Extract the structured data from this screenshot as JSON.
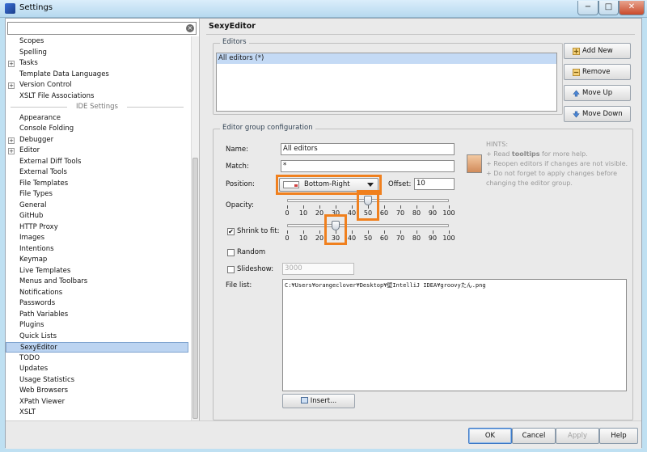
{
  "window": {
    "title": "Settings",
    "min_label": "−",
    "max_label": "□",
    "close_label": "✕"
  },
  "search": {
    "value": ""
  },
  "tree": {
    "items_top": [
      {
        "label": "Scopes",
        "expandable": false
      },
      {
        "label": "Spelling",
        "expandable": false
      },
      {
        "label": "Tasks",
        "expandable": true
      },
      {
        "label": "Template Data Languages",
        "expandable": false
      },
      {
        "label": "Version Control",
        "expandable": true
      },
      {
        "label": "XSLT File Associations",
        "expandable": false
      }
    ],
    "section_label": "IDE Settings",
    "items_bottom": [
      {
        "label": "Appearance",
        "expandable": false
      },
      {
        "label": "Console Folding",
        "expandable": false
      },
      {
        "label": "Debugger",
        "expandable": true
      },
      {
        "label": "Editor",
        "expandable": true
      },
      {
        "label": "External Diff Tools",
        "expandable": false
      },
      {
        "label": "External Tools",
        "expandable": false
      },
      {
        "label": "File Templates",
        "expandable": false
      },
      {
        "label": "File Types",
        "expandable": false
      },
      {
        "label": "General",
        "expandable": false
      },
      {
        "label": "GitHub",
        "expandable": false
      },
      {
        "label": "HTTP Proxy",
        "expandable": false
      },
      {
        "label": "Images",
        "expandable": false
      },
      {
        "label": "Intentions",
        "expandable": false
      },
      {
        "label": "Keymap",
        "expandable": false
      },
      {
        "label": "Live Templates",
        "expandable": false
      },
      {
        "label": "Menus and Toolbars",
        "expandable": false
      },
      {
        "label": "Notifications",
        "expandable": false
      },
      {
        "label": "Passwords",
        "expandable": false
      },
      {
        "label": "Path Variables",
        "expandable": false
      },
      {
        "label": "Plugins",
        "expandable": false
      },
      {
        "label": "Quick Lists",
        "expandable": false
      },
      {
        "label": "SexyEditor",
        "expandable": false,
        "selected": true
      },
      {
        "label": "TODO",
        "expandable": false
      },
      {
        "label": "Updates",
        "expandable": false
      },
      {
        "label": "Usage Statistics",
        "expandable": false
      },
      {
        "label": "Web Browsers",
        "expandable": false
      },
      {
        "label": "XPath Viewer",
        "expandable": false
      },
      {
        "label": "XSLT",
        "expandable": false
      }
    ]
  },
  "panel": {
    "title": "SexyEditor",
    "editors_group_title": "Editors",
    "editors": [
      "All editors (*)"
    ],
    "buttons": {
      "add": "Add New",
      "remove": "Remove",
      "move_up": "Move Up",
      "move_down": "Move Down"
    },
    "config_group_title": "Editor group configuration",
    "name_label": "Name:",
    "name_value": "All editors",
    "match_label": "Match:",
    "match_value": "*",
    "position_label": "Position:",
    "position_value": "Bottom-Right",
    "offset_label": "Offset:",
    "offset_value": "10",
    "opacity_label": "Opacity:",
    "opacity_value": 50,
    "shrink_label": "Shrink to fit:",
    "shrink_checked": true,
    "shrink_value": 30,
    "tick_labels": [
      "0",
      "10",
      "20",
      "30",
      "40",
      "50",
      "60",
      "70",
      "80",
      "90",
      "100"
    ],
    "random_label": "Random",
    "random_checked": false,
    "slideshow_label": "Slideshow:",
    "slideshow_checked": false,
    "slideshow_value": "3000",
    "file_list_label": "File list:",
    "file_list_value": "C:¥Users¥orangeclover¥Desktop¥壁IntelliJ IDEA¥groovyたん.png",
    "insert_label": "Insert...",
    "hints_title": "HINTS:",
    "hints": [
      {
        "prefix": "+ Read ",
        "bold": "tooltips",
        "suffix": " for more help."
      },
      {
        "prefix": "+ Reopen editors if changes are not visible.",
        "bold": "",
        "suffix": ""
      },
      {
        "prefix": "+ Do not forget to apply changes before changing the editor group.",
        "bold": "",
        "suffix": ""
      }
    ]
  },
  "footer": {
    "ok": "OK",
    "cancel": "Cancel",
    "apply": "Apply",
    "help": "Help"
  },
  "colors": {
    "highlight": "#f0801e",
    "selection": "#bcd4f1"
  }
}
